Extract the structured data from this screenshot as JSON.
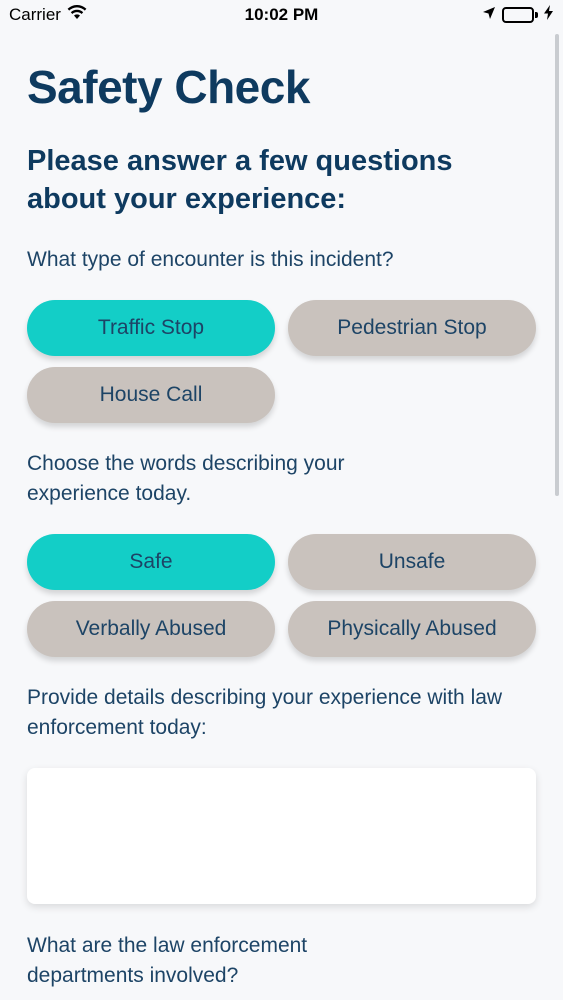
{
  "status_bar": {
    "carrier": "Carrier",
    "time": "10:02 PM"
  },
  "page": {
    "title": "Safety Check",
    "subtitle": "Please answer a few questions about your experience:"
  },
  "encounter": {
    "question": "What type of encounter is this incident?",
    "options": [
      {
        "label": "Traffic Stop",
        "selected": true
      },
      {
        "label": "Pedestrian Stop",
        "selected": false
      },
      {
        "label": "House Call",
        "selected": false
      }
    ]
  },
  "experience": {
    "question": "Choose the words describing your experience today.",
    "options": [
      {
        "label": "Safe",
        "selected": true
      },
      {
        "label": "Unsafe",
        "selected": false
      },
      {
        "label": "Verbally Abused",
        "selected": false
      },
      {
        "label": "Physically Abused",
        "selected": false
      }
    ]
  },
  "details": {
    "question": "Provide details describing your experience with law enforcement today:",
    "value": "",
    "placeholder": ""
  },
  "departments": {
    "question": "What are the law enforcement departments involved?"
  },
  "colors": {
    "selected": "#13cec7",
    "unselected": "#c9c2bd",
    "text": "#0e3a5f",
    "battery": "#4cd964"
  },
  "icons": [
    "wifi-icon",
    "location-arrow-icon",
    "battery-icon",
    "charging-bolt-icon"
  ]
}
